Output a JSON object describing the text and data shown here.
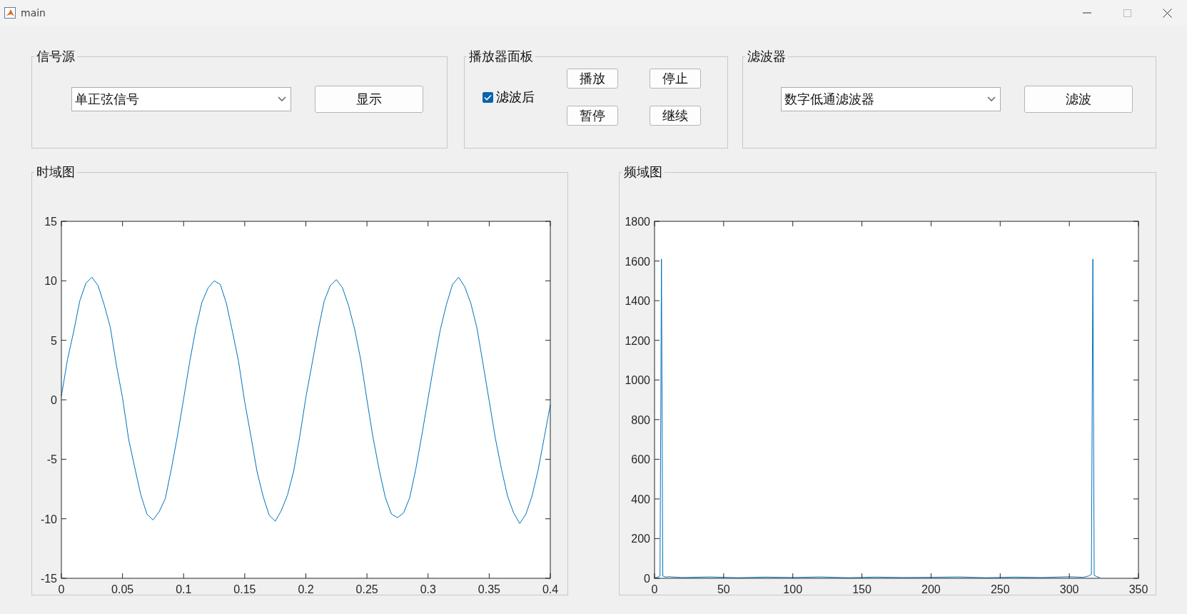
{
  "window": {
    "title": "main"
  },
  "signal_source": {
    "title": "信号源",
    "dropdown": {
      "value": "单正弦信号"
    },
    "button": "显示"
  },
  "player": {
    "title": "播放器面板",
    "checkbox": {
      "label": "滤波后",
      "checked": true
    },
    "buttons": [
      "播放",
      "停止",
      "暂停",
      "继续"
    ]
  },
  "filter": {
    "title": "滤波器",
    "dropdown": {
      "value": "数字低通滤波器"
    },
    "button": "滤波"
  },
  "time_plot": {
    "title": "时域图",
    "chart_data": {
      "type": "line",
      "xlim": [
        0,
        0.4
      ],
      "ylim": [
        -15,
        15
      ],
      "xticks": [
        0,
        0.05,
        0.1,
        0.15,
        0.2,
        0.25,
        0.3,
        0.35,
        0.4
      ],
      "yticks": [
        -15,
        -10,
        -5,
        0,
        5,
        10,
        15
      ],
      "x": [
        0,
        0.005,
        0.01,
        0.015,
        0.02,
        0.025,
        0.03,
        0.035,
        0.04,
        0.045,
        0.05,
        0.055,
        0.06,
        0.065,
        0.07,
        0.075,
        0.08,
        0.085,
        0.09,
        0.095,
        0.1,
        0.105,
        0.11,
        0.115,
        0.12,
        0.125,
        0.13,
        0.135,
        0.14,
        0.145,
        0.15,
        0.155,
        0.16,
        0.165,
        0.17,
        0.175,
        0.18,
        0.185,
        0.19,
        0.195,
        0.2,
        0.205,
        0.21,
        0.215,
        0.22,
        0.225,
        0.23,
        0.235,
        0.24,
        0.245,
        0.25,
        0.255,
        0.26,
        0.265,
        0.27,
        0.275,
        0.28,
        0.285,
        0.29,
        0.295,
        0.3,
        0.305,
        0.31,
        0.315,
        0.32,
        0.325,
        0.33,
        0.335,
        0.34,
        0.345,
        0.35,
        0.355,
        0.36,
        0.365,
        0.37,
        0.375,
        0.38,
        0.385,
        0.39,
        0.395,
        0.4
      ],
      "series": [
        {
          "color": "#0072bd",
          "values": [
            0.3,
            3.4,
            5.7,
            8.3,
            9.8,
            10.3,
            9.6,
            8.0,
            6.1,
            2.9,
            0.2,
            -3.3,
            -5.7,
            -8.0,
            -9.6,
            -10.1,
            -9.4,
            -8.3,
            -5.8,
            -3.0,
            0.1,
            3.2,
            6.0,
            8.2,
            9.4,
            10.0,
            9.7,
            8.1,
            5.7,
            3.2,
            -0.2,
            -3.0,
            -6.0,
            -8.1,
            -9.7,
            -10.2,
            -9.3,
            -8.0,
            -6.0,
            -3.1,
            0.2,
            3.0,
            5.8,
            8.3,
            9.6,
            10.1,
            9.4,
            7.9,
            5.9,
            3.3,
            0.0,
            -3.2,
            -5.9,
            -8.2,
            -9.6,
            -9.9,
            -9.5,
            -8.2,
            -5.8,
            -2.9,
            0.1,
            3.1,
            5.9,
            8.0,
            9.7,
            10.3,
            9.5,
            8.1,
            6.0,
            3.0,
            -0.1,
            -3.2,
            -5.8,
            -8.1,
            -9.5,
            -10.4,
            -9.6,
            -8.1,
            -5.9,
            -3.2,
            -0.4
          ]
        }
      ]
    }
  },
  "freq_plot": {
    "title": "频域图",
    "chart_data": {
      "type": "line",
      "xlim": [
        0,
        350
      ],
      "ylim": [
        0,
        1800
      ],
      "xticks": [
        0,
        50,
        100,
        150,
        200,
        250,
        300,
        350
      ],
      "yticks": [
        0,
        200,
        400,
        600,
        800,
        1000,
        1200,
        1400,
        1600,
        1800
      ],
      "x": [
        0,
        2,
        4,
        5,
        6,
        8,
        10,
        20,
        40,
        60,
        80,
        100,
        120,
        140,
        160,
        180,
        200,
        220,
        240,
        260,
        280,
        300,
        310,
        314,
        316,
        317,
        318,
        320,
        322
      ],
      "series": [
        {
          "color": "#0072bd",
          "values": [
            3,
            5,
            12,
            1610,
            12,
            6,
            8,
            4,
            7,
            3,
            6,
            4,
            7,
            3,
            6,
            4,
            5,
            7,
            3,
            6,
            4,
            8,
            5,
            12,
            20,
            1610,
            15,
            8,
            4
          ]
        }
      ]
    }
  }
}
